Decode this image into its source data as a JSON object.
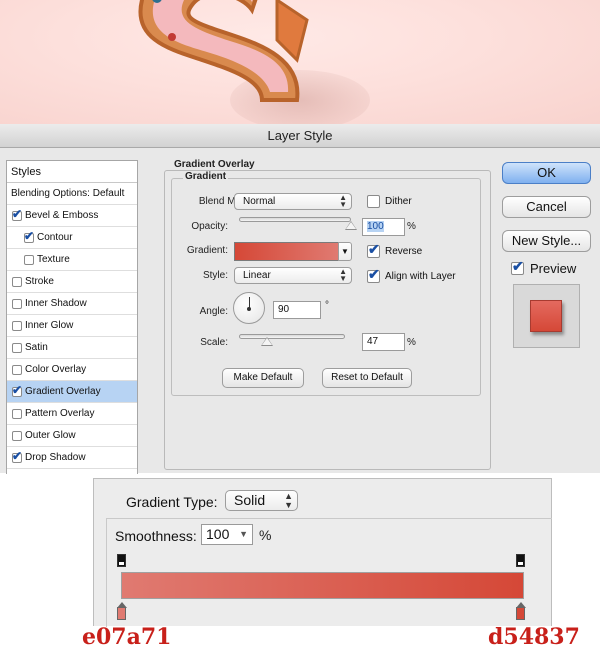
{
  "window": {
    "title": "Layer Style"
  },
  "styles_panel": {
    "header": "Styles",
    "blending": "Blending Options: Default",
    "items": [
      {
        "label": "Bevel & Emboss",
        "checked": true
      },
      {
        "label": "Contour",
        "checked": true
      },
      {
        "label": "Texture",
        "checked": false
      },
      {
        "label": "Stroke",
        "checked": false
      },
      {
        "label": "Inner Shadow",
        "checked": false
      },
      {
        "label": "Inner Glow",
        "checked": false
      },
      {
        "label": "Satin",
        "checked": false
      },
      {
        "label": "Color Overlay",
        "checked": false
      },
      {
        "label": "Gradient Overlay",
        "checked": true,
        "selected": true
      },
      {
        "label": "Pattern Overlay",
        "checked": false
      },
      {
        "label": "Outer Glow",
        "checked": false
      },
      {
        "label": "Drop Shadow",
        "checked": true
      }
    ]
  },
  "gradient_overlay": {
    "group_title": "Gradient Overlay",
    "sub_title": "Gradient",
    "blend_mode_label": "Blend Mode:",
    "blend_mode": "Normal",
    "dither_label": "Dither",
    "dither_checked": false,
    "opacity_label": "Opacity:",
    "opacity": "100",
    "opacity_value": 100,
    "opacity_unit": "%",
    "gradient_label": "Gradient:",
    "reverse_label": "Reverse",
    "reverse_checked": true,
    "style_label": "Style:",
    "style": "Linear",
    "align_label": "Align with Layer",
    "align_checked": true,
    "angle_label": "Angle:",
    "angle": "90",
    "angle_unit": "°",
    "scale_label": "Scale:",
    "scale": "47",
    "scale_value": 47,
    "scale_unit": "%",
    "make_default": "Make Default",
    "reset_default": "Reset to Default"
  },
  "actions": {
    "ok": "OK",
    "cancel": "Cancel",
    "new_style": "New Style...",
    "preview_label": "Preview",
    "preview_checked": true
  },
  "gradient_editor": {
    "type_label": "Gradient Type:",
    "type_value": "Solid",
    "smoothness_label": "Smoothness:",
    "smoothness": "100",
    "smoothness_unit": "%",
    "left_color_label": "e07a71",
    "right_color_label": "d54837"
  },
  "colors": {
    "stop_left": "#e07a71",
    "stop_right": "#d54837",
    "selection": "#b7d3f3",
    "default_button": "#7fb0ef"
  }
}
